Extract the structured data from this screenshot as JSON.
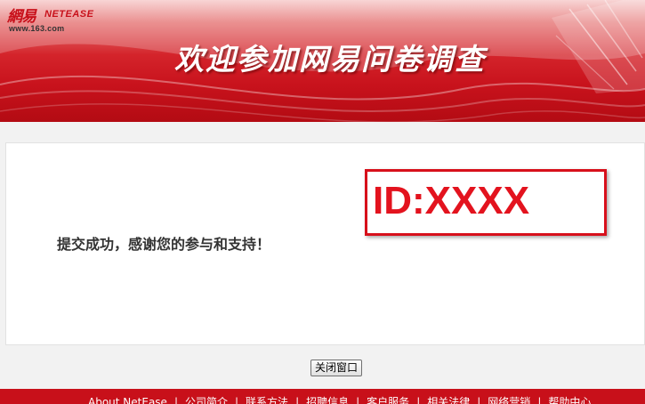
{
  "header": {
    "logo_cn": "網易",
    "logo_en": "NETEASE",
    "logo_url": "www.163.com",
    "title": "欢迎参加网易问卷调查"
  },
  "main": {
    "message": "提交成功，感谢您的参与和支持！",
    "id_label": "ID:XXXX"
  },
  "actions": {
    "close_label": "关闭窗口"
  },
  "footer": {
    "links": [
      "About NetEase",
      "公司简介",
      "联系方法",
      "招聘信息",
      "客户服务",
      "相关法律",
      "网络营销",
      "帮助中心"
    ]
  },
  "colors": {
    "brand_red": "#c8101a",
    "id_red": "#e3131e"
  }
}
